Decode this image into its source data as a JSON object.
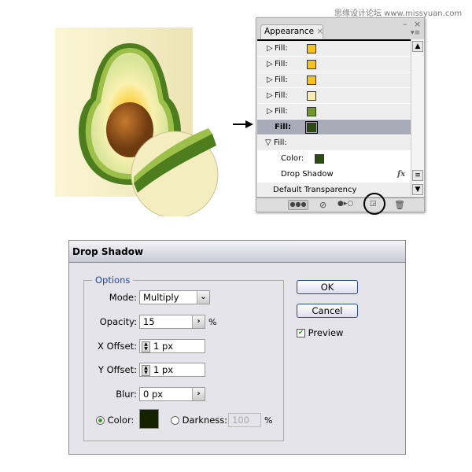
{
  "watermark": "思缘设计论坛 www.missyuan.com",
  "appearance_panel": {
    "tab_label": "Appearance",
    "tab_close": "×",
    "controls": {
      "minimize": "–",
      "close": "×",
      "menu": "▾≡"
    },
    "rows": [
      {
        "label": "Fill:",
        "color": "#f5c21b",
        "state": "collapsed"
      },
      {
        "label": "Fill:",
        "color": "#f5c21b",
        "state": "collapsed"
      },
      {
        "label": "Fill:",
        "color": "#f5c21b",
        "state": "collapsed"
      },
      {
        "label": "Fill:",
        "color": "#f6ebaa",
        "state": "collapsed"
      },
      {
        "label": "Fill:",
        "color": "#6f9a2a",
        "state": "collapsed"
      },
      {
        "label": "Fill:",
        "color": "#2d4d0e",
        "state": "selected"
      },
      {
        "label": "Fill:",
        "state": "expanded"
      }
    ],
    "sub_rows": {
      "color_label": "Color:",
      "color": "#2d4d0e",
      "effect_label": "Drop Shadow",
      "fx": "fx"
    },
    "default_transparency": "Default Transparency"
  },
  "dialog": {
    "title": "Drop Shadow",
    "group_label": "Options",
    "mode": {
      "label": "Mode:",
      "value": "Multiply"
    },
    "opacity": {
      "label": "Opacity:",
      "value": "15",
      "unit": "%"
    },
    "x_offset": {
      "label": "X Offset:",
      "value": "1 px"
    },
    "y_offset": {
      "label": "Y Offset:",
      "value": "1 px"
    },
    "blur": {
      "label": "Blur:",
      "value": "0 px"
    },
    "color": {
      "label": "Color:",
      "selected": true,
      "swatch": "#142200"
    },
    "darkness": {
      "label": "Darkness:",
      "value": "100",
      "unit": "%",
      "selected": false
    },
    "ok_label": "OK",
    "cancel_label": "Cancel",
    "preview": {
      "label": "Preview",
      "checked": true
    }
  }
}
